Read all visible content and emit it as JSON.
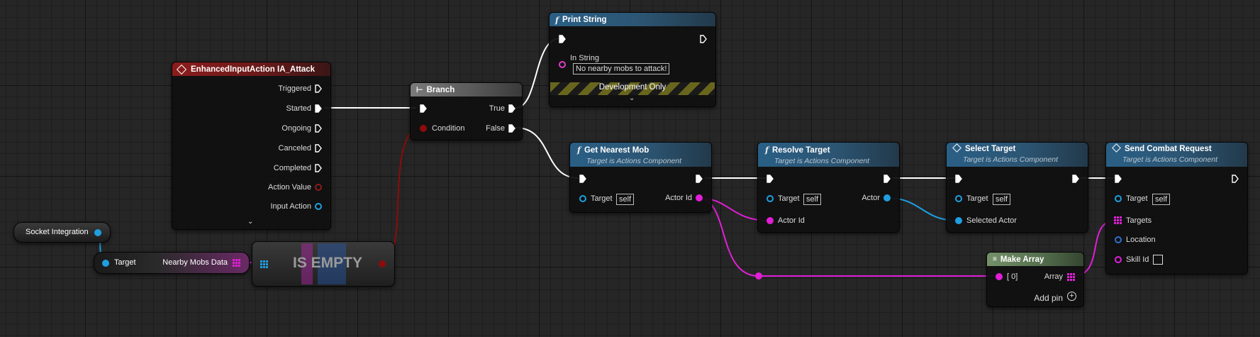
{
  "nodes": {
    "input_action": {
      "title": "EnhancedInputAction IA_Attack",
      "pins": [
        "Triggered",
        "Started",
        "Ongoing",
        "Canceled",
        "Completed",
        "Action Value",
        "Input Action"
      ]
    },
    "branch": {
      "title": "Branch",
      "condition": "Condition",
      "true_label": "True",
      "false_label": "False"
    },
    "print_string": {
      "title": "Print String",
      "in_string_label": "In String",
      "in_string_value": "No nearby mobs to attack!",
      "dev_only": "Development Only"
    },
    "get_nearest_mob": {
      "title": "Get Nearest Mob",
      "subtitle": "Target is Actions Component",
      "target_label": "Target",
      "target_value": "self",
      "output": "Actor Id"
    },
    "resolve_target": {
      "title": "Resolve Target",
      "subtitle": "Target is Actions Component",
      "target_label": "Target",
      "target_value": "self",
      "input": "Actor Id",
      "output": "Actor"
    },
    "select_target": {
      "title": "Select Target",
      "subtitle": "Target is Actions Component",
      "target_label": "Target",
      "target_value": "self",
      "input": "Selected Actor"
    },
    "send_combat_request": {
      "title": "Send Combat Request",
      "subtitle": "Target is Actions Component",
      "target_label": "Target",
      "target_value": "self",
      "targets": "Targets",
      "location": "Location",
      "skill_id": "Skill Id"
    },
    "socket_integration": {
      "title": "Socket Integration"
    },
    "nearby_mobs": {
      "target": "Target",
      "output": "Nearby Mobs Data"
    },
    "is_empty": {
      "title": "IS EMPTY"
    },
    "make_array": {
      "title": "Make Array",
      "index0": "[ 0]",
      "array": "Array",
      "add_pin": "Add pin"
    }
  },
  "colors": {
    "exec_wire": "#ffffff",
    "bool_wire": "#8c0c0c",
    "object_wire": "#1f9fe0",
    "string_wire": "#e13cc8",
    "int_wire": "#e01fd6",
    "bg": "#262626"
  }
}
